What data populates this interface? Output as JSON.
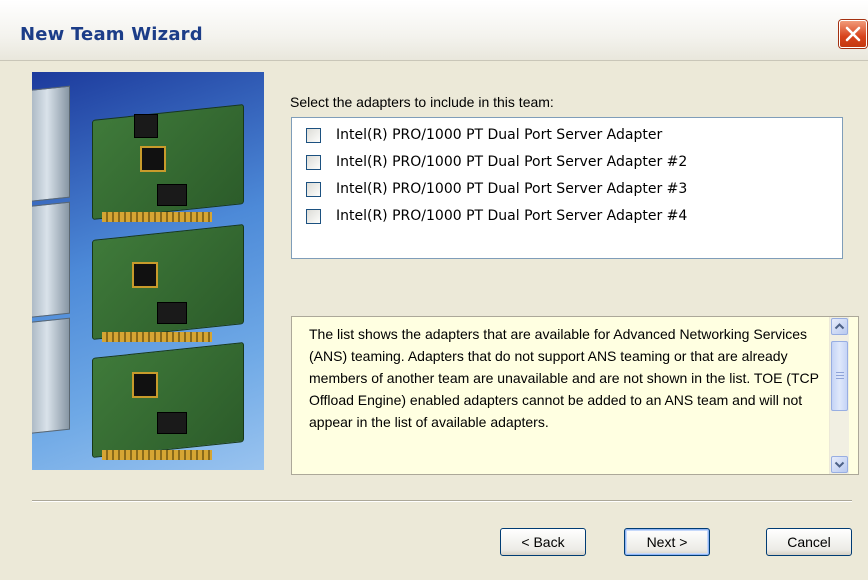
{
  "window": {
    "title": "New Team Wizard"
  },
  "titlebar": {
    "close_icon": "close-icon"
  },
  "adapters": {
    "label": "Select the adapters to include in this team:",
    "items": [
      {
        "label": "Intel(R) PRO/1000 PT Dual Port Server Adapter",
        "checked": false
      },
      {
        "label": "Intel(R) PRO/1000 PT Dual Port Server Adapter #2",
        "checked": false
      },
      {
        "label": "Intel(R) PRO/1000 PT Dual Port Server Adapter #3",
        "checked": false
      },
      {
        "label": "Intel(R) PRO/1000 PT Dual Port Server Adapter #4",
        "checked": false
      }
    ]
  },
  "info": {
    "text": "The list shows the adapters that are available for Advanced Networking Services (ANS) teaming. Adapters that do not support ANS teaming or that are already members of another team are unavailable and are not shown in the list. TOE (TCP Offload Engine) enabled adapters cannot be added to an ANS team and will not appear in the list of available adapters."
  },
  "buttons": {
    "back": "< Back",
    "next": "Next >",
    "cancel": "Cancel"
  },
  "colors": {
    "title": "#1c3d88",
    "info_bg": "#ffffe1",
    "close": "#d8431c"
  }
}
